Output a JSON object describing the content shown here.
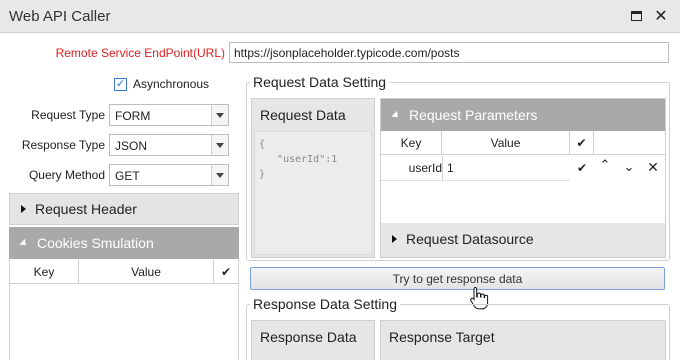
{
  "window": {
    "title": "Web API Caller"
  },
  "endpoint": {
    "label": "Remote Service EndPoint(URL)",
    "value": "https://jsonplaceholder.typicode.com/posts"
  },
  "async": {
    "label": "Asynchronous",
    "checked": true
  },
  "form": {
    "request_type": {
      "label": "Request Type",
      "value": "FORM"
    },
    "response_type": {
      "label": "Response Type",
      "value": "JSON"
    },
    "query_method": {
      "label": "Query Method",
      "value": "GET"
    }
  },
  "left_panels": {
    "request_header": "Request Header",
    "cookies": "Cookies Smulation",
    "cookies_columns": {
      "key": "Key",
      "value": "Value"
    }
  },
  "request_setting": {
    "title": "Request Data Setting",
    "request_data": {
      "title": "Request Data",
      "code": "{\n   \"userId\":1\n}"
    },
    "request_parameters": {
      "title": "Request Parameters",
      "columns": {
        "key": "Key",
        "value": "Value"
      },
      "rows": [
        {
          "key": "userId",
          "value": "1"
        }
      ]
    },
    "request_datasource": "Request Datasource"
  },
  "try_button": "Try to get response data",
  "response_setting": {
    "title": "Response Data Setting",
    "response_data": "Response Data",
    "response_target": "Response Target"
  },
  "colors": {
    "required_label": "#e02020",
    "active_header": "#a9a9a9",
    "button_border": "#7aa3d8"
  }
}
